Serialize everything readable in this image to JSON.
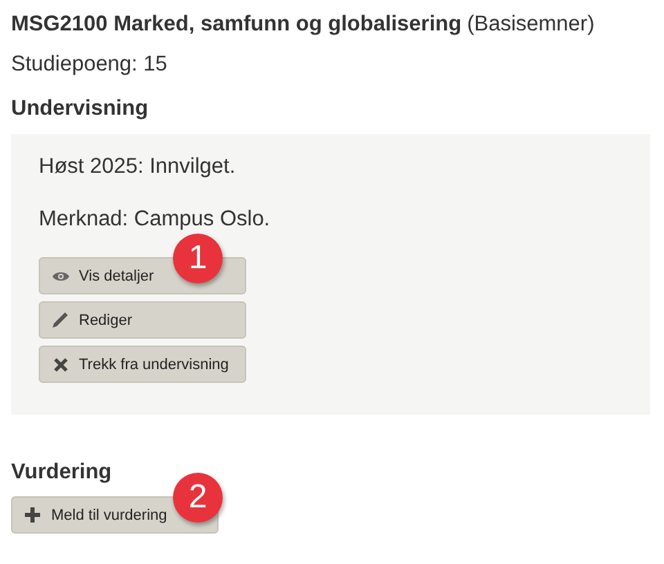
{
  "course": {
    "code_and_name": "MSG2100 Marked, samfunn og globalisering",
    "category": "(Basisemner)",
    "credits": "Studiepoeng: 15"
  },
  "teaching": {
    "heading": "Undervisning",
    "lines": [
      "Høst 2025: Innvilget.",
      "Merknad: Campus Oslo."
    ],
    "buttons": [
      {
        "label": "Vis detaljer",
        "kind": "eye",
        "callout": "1"
      },
      {
        "label": "Rediger",
        "kind": "pencil"
      },
      {
        "label": "Trekk fra undervisning",
        "kind": "cross"
      }
    ]
  },
  "assessment": {
    "heading": "Vurdering",
    "buttons": [
      {
        "label": "Meld til vurdering",
        "kind": "plus",
        "callout": "2"
      }
    ]
  }
}
